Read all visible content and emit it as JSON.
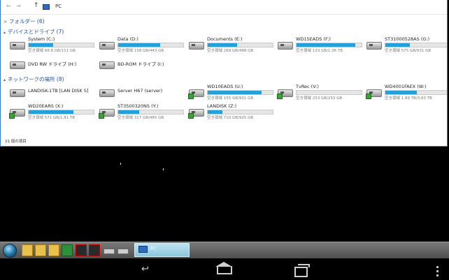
{
  "address": {
    "path": "PC",
    "back": "←",
    "forward": "→",
    "up": "↑"
  },
  "groups": {
    "folders": "フォルダー (6)",
    "devices": "デバイスとドライブ (7)",
    "network": "ネットワークの場所 (8)"
  },
  "devices": [
    {
      "name": "System (C:)",
      "sub": "空き領域 68.8 GB/111 GB",
      "fill": 0.38
    },
    {
      "name": "Data (D:)",
      "sub": "空き領域 158 GB/443 GB",
      "fill": 0.64
    },
    {
      "name": "Documents (E:)",
      "sub": "空き領域 269 GB/488 GB",
      "fill": 0.45
    },
    {
      "name": "WD15EADS (F:)",
      "sub": "空き領域 133 GB/1.36 TB",
      "fill": 0.9
    },
    {
      "name": "ST31000528AS (G:)",
      "sub": "空き領域 575 GB/931 GB",
      "fill": 0.38
    },
    {
      "name": "DVD RW ドライブ (H:)",
      "sub": "",
      "fill": null
    },
    {
      "name": "BD-ROM ドライブ (I:)",
      "sub": "",
      "fill": null
    }
  ],
  "network": [
    {
      "name": "LANDISK-1TB [LAN DISK S]",
      "sub": "",
      "fill": null
    },
    {
      "name": "Server H67 (server)",
      "sub": "",
      "fill": null
    },
    {
      "name": "WD10EADS (U:)",
      "sub": "空き領域 155 GB/931 GB",
      "fill": 0.83
    },
    {
      "name": "TvRec (V:)",
      "sub": "空き領域 253 GB/253 GB",
      "fill": 0.0
    },
    {
      "name": "WD4001FAEX (W:)",
      "sub": "空き領域 1.89 TB/3.63 TB",
      "fill": 0.48
    },
    {
      "name": "WD20EARS (X:)",
      "sub": "空き領域 571 GB/1.81 TB",
      "fill": 0.69
    },
    {
      "name": "ST3500320NS (Y:)",
      "sub": "空き領域 317 GB/465 GB",
      "fill": 0.32
    },
    {
      "name": "LANDISK (Z:)",
      "sub": "空き領域 710 GB/925 GB",
      "fill": 0.23
    }
  ],
  "status": "21 個の項目",
  "taskbar": {
    "task_label": "PC"
  },
  "colors": {
    "accent": "#26a0da",
    "border": "#3b78c6",
    "group": "#1e4f9c"
  }
}
